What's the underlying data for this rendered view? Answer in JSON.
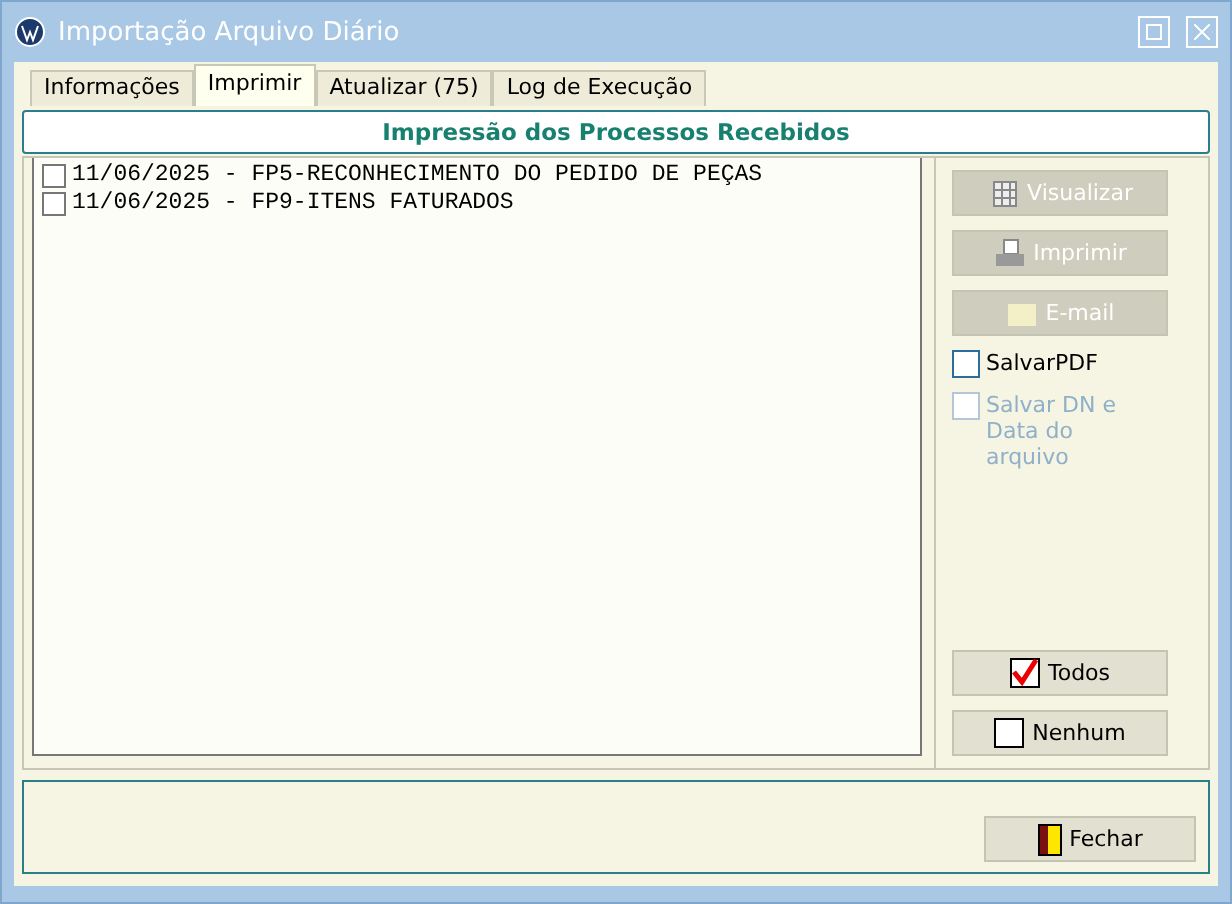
{
  "window": {
    "title": "Importação Arquivo Diário"
  },
  "tabs": [
    {
      "label": "Informações",
      "selected": false
    },
    {
      "label": "Imprimir",
      "selected": true
    },
    {
      "label": "Atualizar (75)",
      "selected": false
    },
    {
      "label": "Log de Execução",
      "selected": false
    }
  ],
  "panel": {
    "title": "Impressão dos Processos Recebidos"
  },
  "processes": [
    {
      "label": "11/06/2025 - FP5-RECONHECIMENTO DO PEDIDO DE PEÇAS",
      "checked": false
    },
    {
      "label": "11/06/2025 - FP9-ITENS FATURADOS",
      "checked": false
    }
  ],
  "actions": [
    {
      "kind": "preview",
      "label": "Visualizar",
      "disabled": true
    },
    {
      "kind": "print",
      "label": "Imprimir",
      "disabled": true
    },
    {
      "kind": "email",
      "label": "E-mail",
      "disabled": true
    }
  ],
  "options": [
    {
      "label": "SalvarPDF",
      "checked": false,
      "disabled": false
    },
    {
      "label": "Salvar DN e Data do arquivo",
      "checked": false,
      "disabled": true
    }
  ],
  "selection_buttons": [
    {
      "kind": "all",
      "label": "Todos"
    },
    {
      "kind": "none",
      "label": "Nenhum"
    }
  ],
  "close_button": {
    "label": "Fechar"
  }
}
